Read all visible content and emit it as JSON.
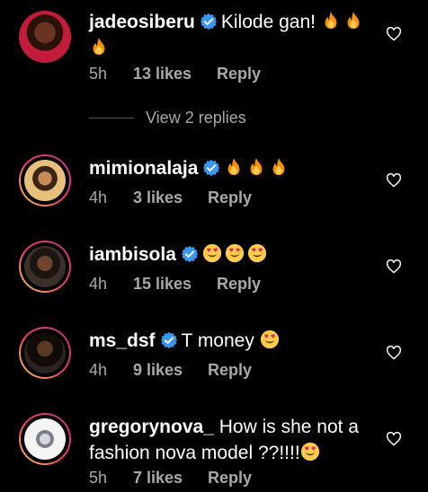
{
  "colors": {
    "background": "#000000",
    "verified": "#3897f0",
    "meta": "#a8a8a8"
  },
  "comments": [
    {
      "username": "jadeosiberu",
      "text": "Kilode gan!",
      "emojis": [
        "fire",
        "fire",
        "fire"
      ],
      "time": "5h",
      "likes": "13 likes",
      "reply": "Reply"
    },
    {
      "username": "mimionalaja",
      "text": "",
      "emojis": [
        "fire",
        "fire",
        "fire"
      ],
      "time": "4h",
      "likes": "3 likes",
      "reply": "Reply"
    },
    {
      "username": "iambisola",
      "text": "",
      "emojis": [
        "heart-eyes",
        "heart-eyes",
        "heart-eyes"
      ],
      "time": "4h",
      "likes": "15 likes",
      "reply": "Reply"
    },
    {
      "username": "ms_dsf",
      "text": "T money",
      "emojis": [
        "heart-eyes"
      ],
      "time": "4h",
      "likes": "9 likes",
      "reply": "Reply"
    },
    {
      "username": "gregorynova_",
      "text": "How is she not a fashion nova model ??!!!!",
      "emojis": [
        "heart-eyes"
      ],
      "time": "5h",
      "likes": "7 likes",
      "reply": "Reply"
    }
  ],
  "view_replies": "View 2 replies"
}
